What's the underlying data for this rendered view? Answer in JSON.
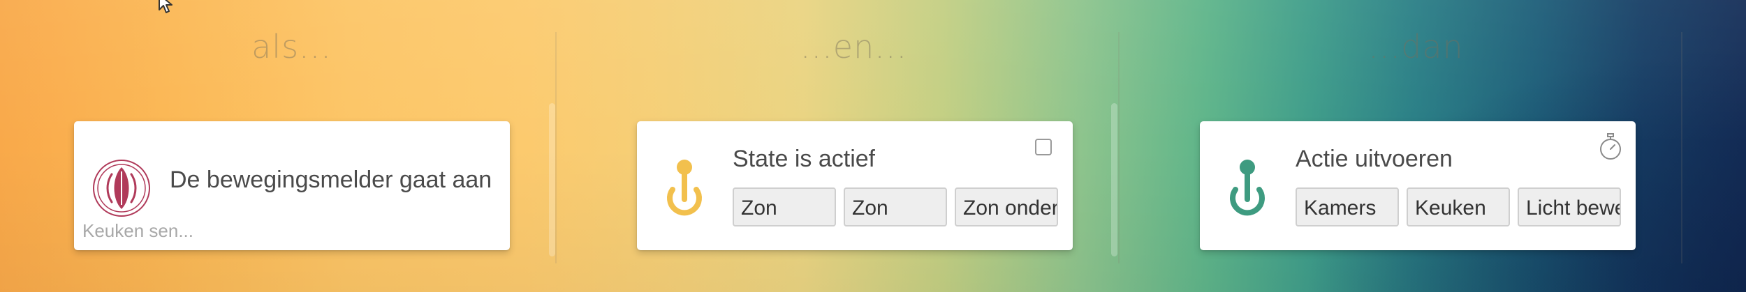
{
  "columns": {
    "if": {
      "heading": "als..."
    },
    "and": {
      "heading": "...en..."
    },
    "then": {
      "heading": "...dan"
    }
  },
  "trigger_card": {
    "title": "De bewegingsmelder gaat aan",
    "subtitle": "Keuken sen...",
    "icon": "motion-sensor-logo-icon",
    "icon_color": "#b03a5a"
  },
  "condition_card": {
    "title": "State is actief",
    "chips": [
      "Zon",
      "Zon",
      "Zon onder"
    ],
    "icon": "power-icon",
    "icon_color": "#f2c04d"
  },
  "action_card": {
    "title": "Actie uitvoeren",
    "chips": [
      "Kamers",
      "Keuken",
      "Licht bewegingsmelder"
    ],
    "icon": "power-icon",
    "icon_color": "#3e9b80"
  }
}
